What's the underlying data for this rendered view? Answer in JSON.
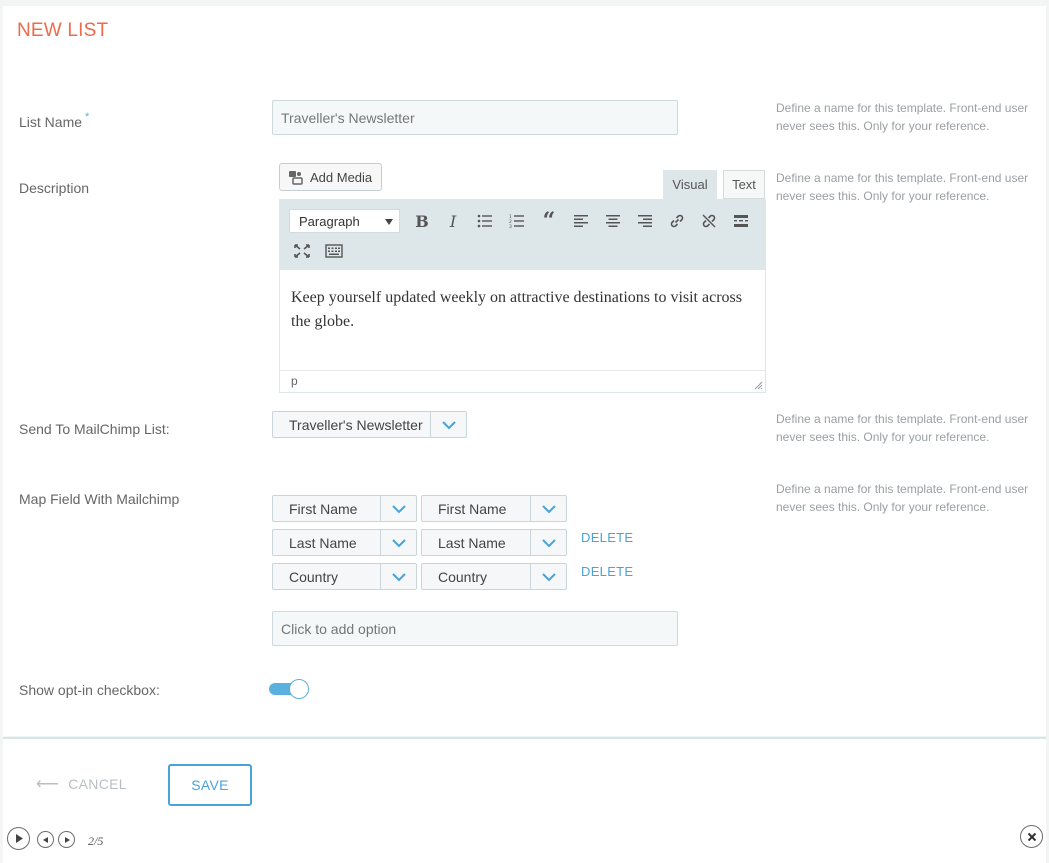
{
  "page": {
    "title": "NEW LIST"
  },
  "fields": {
    "list_name": {
      "label": "List Name",
      "required_mark": "*",
      "value": "Traveller's Newsletter",
      "hint": "Define a name for this template. Front-end user never sees this. Only for your reference."
    },
    "description": {
      "label": "Description",
      "hint": "Define a name for this template. Front-end user never sees this. Only for your reference.",
      "add_media_label": "Add Media",
      "tabs": {
        "visual": "Visual",
        "text": "Text"
      },
      "format_select": "Paragraph",
      "content": "Keep yourself updated weekly on attractive destinations to visit across the globe.",
      "status_path": "p",
      "toolbar_icons": [
        "bold-icon",
        "italic-icon",
        "bullet-list-icon",
        "numbered-list-icon",
        "blockquote-icon",
        "align-left-icon",
        "align-center-icon",
        "align-right-icon",
        "link-icon",
        "unlink-icon",
        "read-more-icon",
        "fullscreen-icon",
        "toolbar-toggle-icon"
      ]
    },
    "send_to": {
      "label": "Send To MailChimp List:",
      "value": "Traveller's Newsletter",
      "hint": "Define a name for this template. Front-end user never sees this. Only for your reference."
    },
    "map_field": {
      "label": "Map Field With Mailchimp",
      "hint": "Define a name for this template. Front-end user never sees this. Only for your reference.",
      "rows": [
        {
          "left": "First Name",
          "right": "First Name",
          "delete": ""
        },
        {
          "left": "Last Name",
          "right": "Last Name",
          "delete": "DELETE"
        },
        {
          "left": "Country",
          "right": "Country",
          "delete": "DELETE"
        }
      ],
      "add_option_placeholder": "Click to add option"
    },
    "opt_in": {
      "label": "Show opt-in checkbox:",
      "enabled": true
    }
  },
  "footer": {
    "cancel_label": "CANCEL",
    "save_label": "SAVE"
  },
  "playback": {
    "page_indicator": "2/5"
  },
  "colors": {
    "accent": "#4aa3d8",
    "title": "#ec6b4d",
    "toolbar": "#dde6e8"
  }
}
